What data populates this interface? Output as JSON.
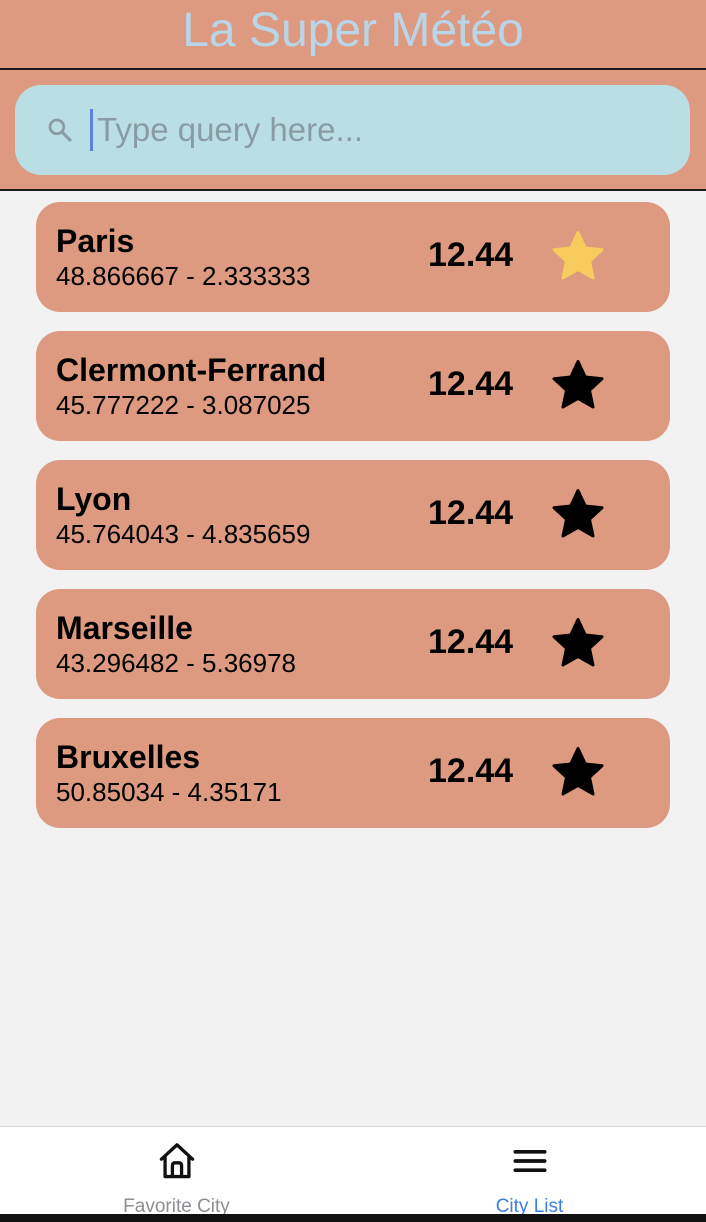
{
  "app": {
    "title": "La Super Météo"
  },
  "search": {
    "placeholder": "Type query here...",
    "value": ""
  },
  "cities": [
    {
      "name": "Paris",
      "coords": "48.866667 - 2.333333",
      "temp": "12.44",
      "favorite": true
    },
    {
      "name": "Clermont-Ferrand",
      "coords": "45.777222 - 3.087025",
      "temp": "12.44",
      "favorite": false
    },
    {
      "name": "Lyon",
      "coords": "45.764043 - 4.835659",
      "temp": "12.44",
      "favorite": false
    },
    {
      "name": "Marseille",
      "coords": "43.296482 - 5.36978",
      "temp": "12.44",
      "favorite": false
    },
    {
      "name": "Bruxelles",
      "coords": "50.85034 - 4.35171",
      "temp": "12.44",
      "favorite": false
    }
  ],
  "tabs": [
    {
      "label": "Favorite City",
      "icon": "home-icon",
      "active": false
    },
    {
      "label": "City List",
      "icon": "menu-icon",
      "active": true
    }
  ],
  "colors": {
    "header_bg": "#de9a80",
    "title": "#b8d6ea",
    "search_bg": "#b9dfe4",
    "card_bg": "#de9a80",
    "star_favorite": "#f8cc5c",
    "star_default": "#000000",
    "tab_active": "#3b7fe6",
    "tab_inactive": "#8e8e93"
  }
}
